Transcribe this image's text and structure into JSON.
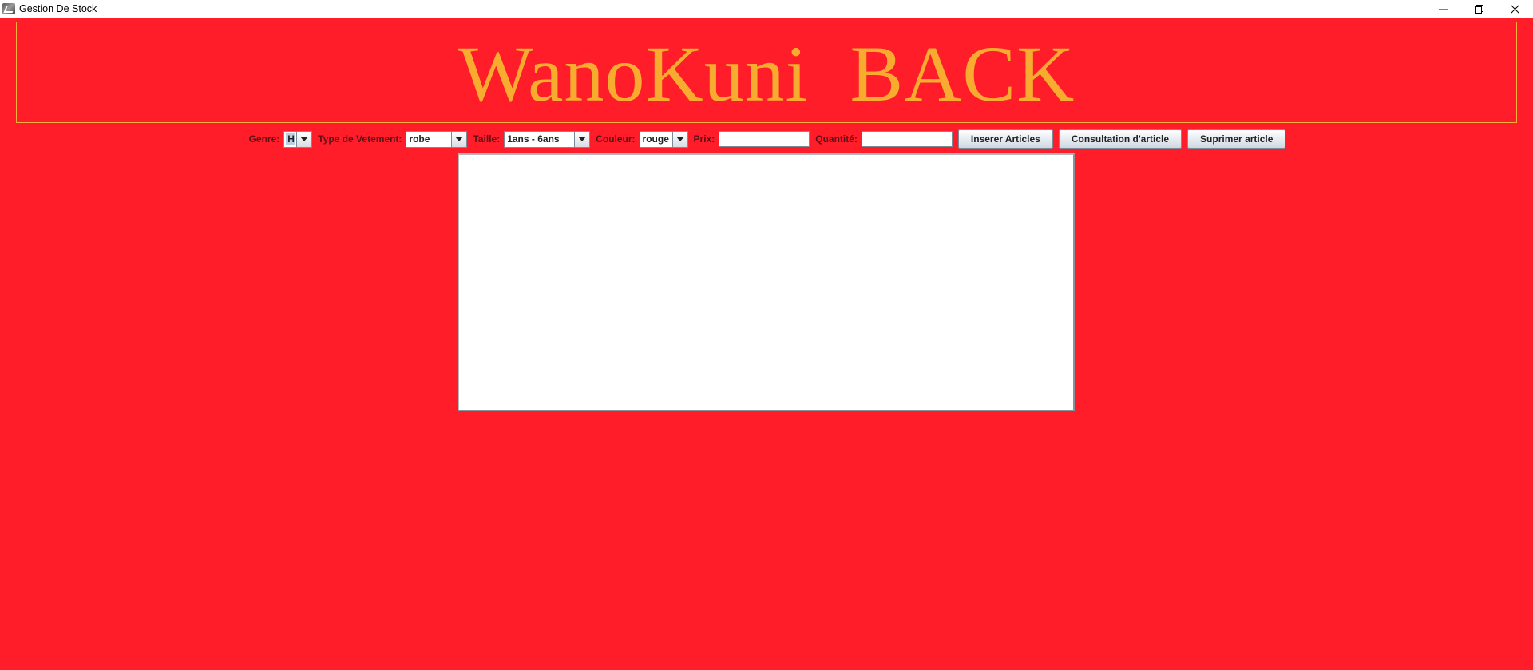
{
  "window": {
    "title": "Gestion De Stock",
    "icon": "app-icon",
    "controls": [
      "minimize-icon",
      "restore-icon",
      "close-icon"
    ]
  },
  "banner": {
    "text": "WanoKuni  BACK"
  },
  "form": {
    "genre": {
      "label": "Genre:",
      "value": "H"
    },
    "type_vetement": {
      "label": "Type de Vetement:",
      "value": "robe"
    },
    "taille": {
      "label": "Taille:",
      "value": "1ans - 6ans"
    },
    "couleur": {
      "label": "Couleur:",
      "value": "rouge"
    },
    "prix": {
      "label": "Prix:",
      "value": ""
    },
    "quantite": {
      "label": "Quantité:",
      "value": ""
    }
  },
  "buttons": {
    "inserer": "Inserer Articles",
    "consultation": "Consultation d'article",
    "supprimer": "Suprimer article"
  },
  "colors": {
    "background": "#ff1d2a",
    "banner_text": "#f7ab2f",
    "banner_border": "#f5b03a"
  }
}
